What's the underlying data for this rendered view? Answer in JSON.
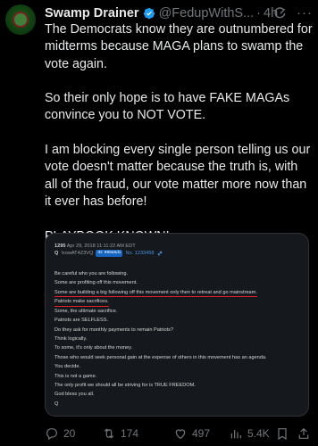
{
  "tweet": {
    "author_name": "Swamp Drainer",
    "handle": "@FedupWithS...",
    "time": "4h",
    "separator": "·",
    "more": "···",
    "paragraphs": [
      "The Democrats know they are outnumbered for midterms because MAGA plans to swamp the vote again.",
      "",
      "So their only hope is to have FAKE MAGAs convince you to NOT VOTE.",
      "",
      "I am blocking every single person telling us our vote doesn't matter because the truth is, with all of the fraud, our vote matter more now than it ever has before!",
      "",
      "PLAYBOOK KNOWN!"
    ]
  },
  "qpost": {
    "number": "1295",
    "date": "Apr 29, 2018 11:11:22 AM EDT",
    "q": "Q",
    "trip": "!xowAT4Z3VQ",
    "tag": "ID: 998a5d1",
    "post_no": "No. 1233458",
    "lines": [
      "Be careful who you are following.",
      "Some are profiting off this movement.",
      "Some are building a big following off this movement only then to retreat and go mainstream.",
      "Patriots make sacrifices.",
      "Some, the ultimate sacrifice.",
      "Patriots are SELFLESS.",
      "Do they ask for monthly payments to remain Patriots?",
      "Think logically.",
      "To some, it's only about the money.",
      "Those who would seek personal gain at the expense of others in this movement has an agenda.",
      "You decide.",
      "This is not a game.",
      "The only profit we should all be striving for is TRUE FREEDOM.",
      "God bless you all.",
      "Q"
    ],
    "underlined_lines": [
      2,
      3
    ]
  },
  "actions": {
    "replies": "20",
    "reposts": "174",
    "likes": "497",
    "views": "5.4K"
  },
  "colors": {
    "background": "#000000",
    "text": "#e7e9ea",
    "muted": "#71767b",
    "verified": "#1d9bf0",
    "underline": "#e0202a"
  }
}
